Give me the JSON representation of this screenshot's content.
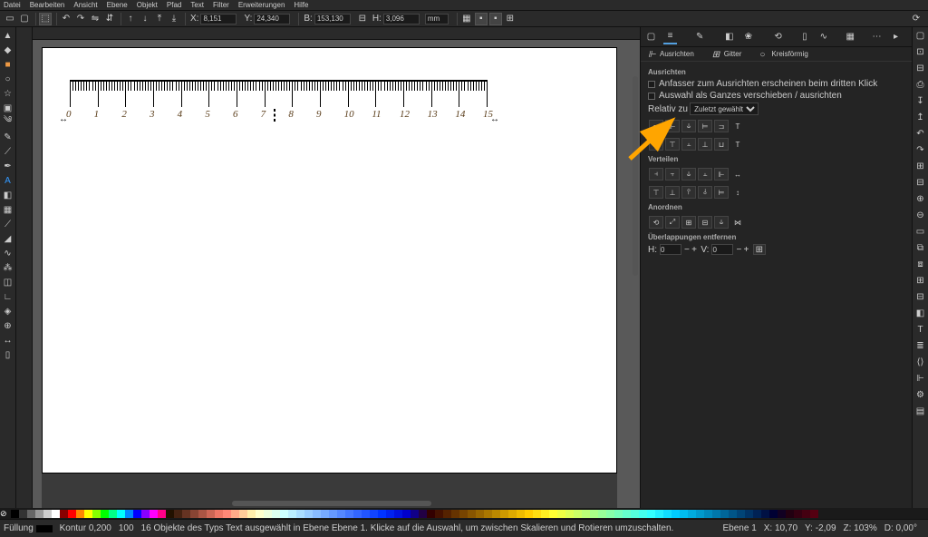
{
  "menu": [
    "Datei",
    "Bearbeiten",
    "Ansicht",
    "Ebene",
    "Objekt",
    "Pfad",
    "Text",
    "Filter",
    "Erweiterungen",
    "Hilfe"
  ],
  "toolbar": {
    "x_lbl": "X:",
    "x_val": "8,151",
    "y_lbl": "Y:",
    "y_val": "24,340",
    "w_lbl": "B:",
    "w_val": "153,130",
    "h_lbl": "H:",
    "h_val": "3,096",
    "unit": "mm"
  },
  "ruler_numbers": [
    "0",
    "1",
    "2",
    "3",
    "4",
    "5",
    "6",
    "7",
    "8",
    "9",
    "10",
    "11",
    "12",
    "13",
    "14",
    "15"
  ],
  "panel": {
    "subtabs": {
      "align": "Ausrichten",
      "grid": "Gitter",
      "circ": "Kreisförmig"
    },
    "s1": "Ausrichten",
    "opt1": "Anfasser zum Ausrichten erscheinen beim dritten Klick",
    "opt2": "Auswahl als Ganzes verschieben / ausrichten",
    "rel_lbl": "Relativ zu",
    "rel_val": "Zuletzt gewählt",
    "s2": "Verteilen",
    "s3": "Anordnen",
    "s4": "Überlappungen entfernen",
    "hv": {
      "h_lbl": "H:",
      "h_val": "0",
      "v_lbl": "V:",
      "v_val": "0"
    }
  },
  "status": {
    "fill": "Füllung",
    "stroke": "Kontur",
    "opacity": "100",
    "strokeval": "0,200",
    "msg": "16 Objekte des Typs Text ausgewählt in Ebene Ebene 1. Klicke auf die Auswahl, um zwischen Skalieren und Rotieren umzuschalten.",
    "layer": "Ebene 1",
    "xcoord": "X: 10,70",
    "ycoord": "Y: -2,09",
    "zoom": "103%",
    "rot": "0,00°"
  },
  "palette": [
    "#000",
    "#333",
    "#666",
    "#999",
    "#ccc",
    "#fff",
    "#800",
    "#f00",
    "#f80",
    "#ff0",
    "#8f0",
    "#0f0",
    "#0f8",
    "#0ff",
    "#08f",
    "#00f",
    "#80f",
    "#f0f",
    "#f08",
    "#210",
    "#421",
    "#632",
    "#843",
    "#a54",
    "#c65",
    "#e76",
    "#f87",
    "#fa8",
    "#fc9",
    "#fea",
    "#ffc",
    "#efd",
    "#dfe",
    "#cff",
    "#bef",
    "#adf",
    "#9cf",
    "#8bf",
    "#7af",
    "#69f",
    "#58f",
    "#47f",
    "#36f",
    "#25f",
    "#14f",
    "#03f",
    "#02e",
    "#01d",
    "#00c",
    "#108",
    "#204",
    "#300",
    "#410",
    "#520",
    "#630",
    "#740",
    "#850",
    "#960",
    "#a70",
    "#b80",
    "#c90",
    "#da0",
    "#eb0",
    "#fc0",
    "#fd1",
    "#fe2",
    "#ff3",
    "#ef4",
    "#df5",
    "#cf6",
    "#bf7",
    "#af8",
    "#9f9",
    "#8fa",
    "#7fb",
    "#6fc",
    "#5fd",
    "#4fe",
    "#3ff",
    "#2ef",
    "#1df",
    "#0cf",
    "#0be",
    "#0ad",
    "#09c",
    "#08b",
    "#07a",
    "#069",
    "#058",
    "#047",
    "#036",
    "#025",
    "#014",
    "#003",
    "#102",
    "#201",
    "#301",
    "#401",
    "#501"
  ]
}
